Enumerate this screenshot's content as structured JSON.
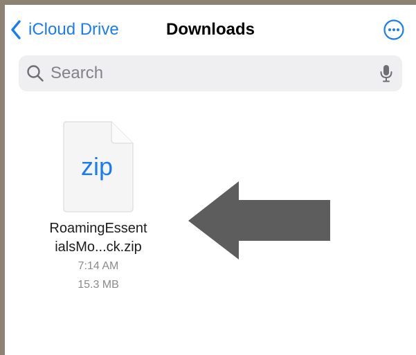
{
  "nav": {
    "back_label": "iCloud Drive",
    "title": "Downloads",
    "back_icon": "chevron-left-icon",
    "more_icon": "ellipsis-circle-icon"
  },
  "search": {
    "placeholder": "Search",
    "value": "",
    "search_icon": "magnifying-glass-icon",
    "mic_icon": "microphone-icon"
  },
  "files": [
    {
      "type_label": "zip",
      "name_line1": "RoamingEssent",
      "name_line2": "ialsMo...ck.zip",
      "time": "7:14 AM",
      "size": "15.3 MB"
    }
  ],
  "overlay": {
    "arrow_icon": "left-arrow-icon",
    "direction": "left"
  },
  "colors": {
    "accent": "#1a7cf5",
    "frame": "#8e8372",
    "arrow": "#5d5d5d",
    "search_bg": "#efeff1"
  }
}
